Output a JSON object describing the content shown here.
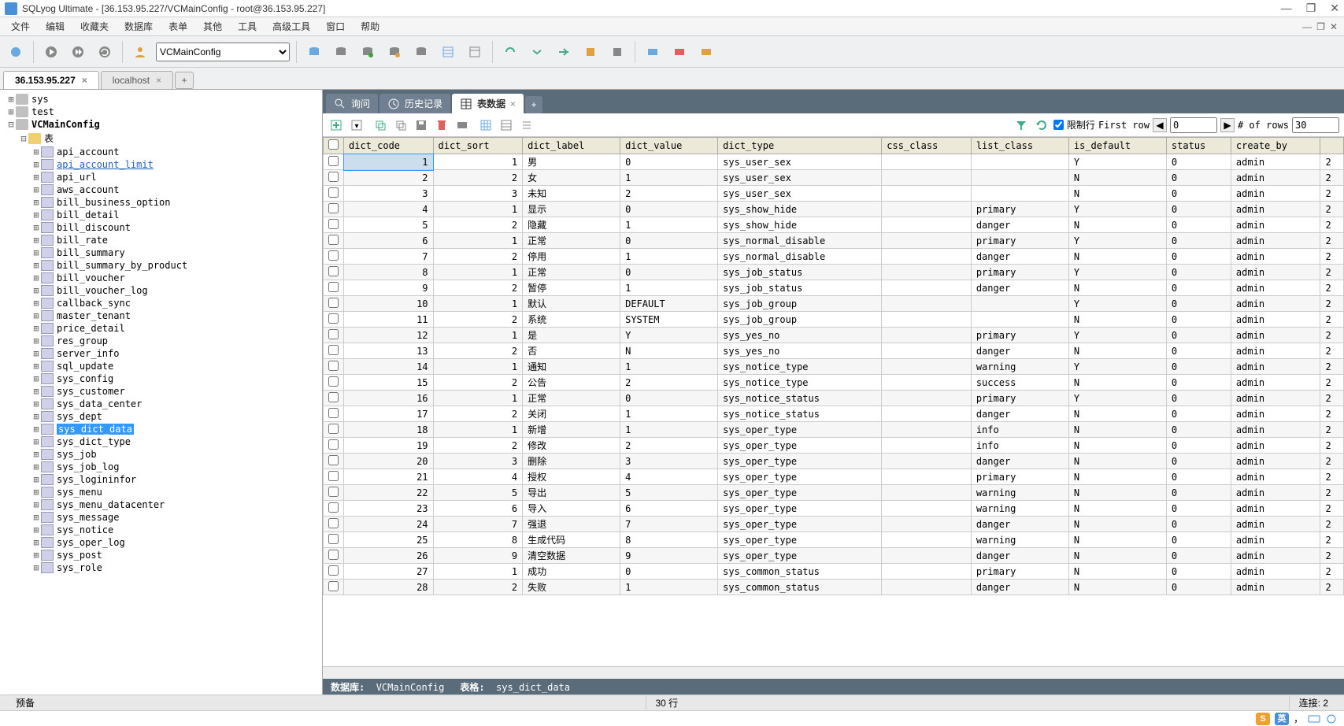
{
  "title": "SQLyog Ultimate - [36.153.95.227/VCMainConfig - root@36.153.95.227]",
  "menus": [
    "文件",
    "编辑",
    "收藏夹",
    "数据库",
    "表单",
    "其他",
    "工具",
    "高级工具",
    "窗口",
    "帮助"
  ],
  "db_selector": "VCMainConfig",
  "conn_tabs": [
    {
      "label": "36.153.95.227",
      "active": true
    },
    {
      "label": "localhost",
      "active": false
    }
  ],
  "tree": {
    "databases": [
      {
        "name": "sys",
        "expanded": false
      },
      {
        "name": "test",
        "expanded": false
      },
      {
        "name": "VCMainConfig",
        "expanded": true,
        "bold": true
      }
    ],
    "tables_folder_label": "表",
    "tables": [
      {
        "name": "api_account"
      },
      {
        "name": "api_account_limit",
        "hover": true
      },
      {
        "name": "api_url"
      },
      {
        "name": "aws_account"
      },
      {
        "name": "bill_business_option"
      },
      {
        "name": "bill_detail"
      },
      {
        "name": "bill_discount"
      },
      {
        "name": "bill_rate"
      },
      {
        "name": "bill_summary"
      },
      {
        "name": "bill_summary_by_product"
      },
      {
        "name": "bill_voucher"
      },
      {
        "name": "bill_voucher_log"
      },
      {
        "name": "callback_sync"
      },
      {
        "name": "master_tenant"
      },
      {
        "name": "price_detail"
      },
      {
        "name": "res_group"
      },
      {
        "name": "server_info"
      },
      {
        "name": "sql_update"
      },
      {
        "name": "sys_config"
      },
      {
        "name": "sys_customer"
      },
      {
        "name": "sys_data_center"
      },
      {
        "name": "sys_dept"
      },
      {
        "name": "sys_dict_data",
        "selected": true
      },
      {
        "name": "sys_dict_type"
      },
      {
        "name": "sys_job"
      },
      {
        "name": "sys_job_log"
      },
      {
        "name": "sys_logininfor"
      },
      {
        "name": "sys_menu"
      },
      {
        "name": "sys_menu_datacenter"
      },
      {
        "name": "sys_message"
      },
      {
        "name": "sys_notice"
      },
      {
        "name": "sys_oper_log"
      },
      {
        "name": "sys_post"
      },
      {
        "name": "sys_role"
      }
    ]
  },
  "content_tabs": [
    {
      "label": "询问",
      "icon": "query",
      "active": false
    },
    {
      "label": "历史记录",
      "icon": "history",
      "active": false
    },
    {
      "label": "表数据",
      "icon": "table",
      "active": true
    }
  ],
  "paging": {
    "limit_label": "限制行",
    "first_row_label": "First row",
    "first_row_value": "0",
    "num_rows_label": "# of rows",
    "num_rows_value": "30"
  },
  "columns": [
    "dict_code",
    "dict_sort",
    "dict_label",
    "dict_value",
    "dict_type",
    "css_class",
    "list_class",
    "is_default",
    "status",
    "create_by"
  ],
  "rows": [
    {
      "dict_code": "1",
      "dict_sort": "1",
      "dict_label": "男",
      "dict_value": "0",
      "dict_type": "sys_user_sex",
      "css_class": "",
      "list_class": "",
      "is_default": "Y",
      "status": "0",
      "create_by": "admin",
      "extra": "2"
    },
    {
      "dict_code": "2",
      "dict_sort": "2",
      "dict_label": "女",
      "dict_value": "1",
      "dict_type": "sys_user_sex",
      "css_class": "",
      "list_class": "",
      "is_default": "N",
      "status": "0",
      "create_by": "admin",
      "extra": "2"
    },
    {
      "dict_code": "3",
      "dict_sort": "3",
      "dict_label": "未知",
      "dict_value": "2",
      "dict_type": "sys_user_sex",
      "css_class": "",
      "list_class": "",
      "is_default": "N",
      "status": "0",
      "create_by": "admin",
      "extra": "2"
    },
    {
      "dict_code": "4",
      "dict_sort": "1",
      "dict_label": "显示",
      "dict_value": "0",
      "dict_type": "sys_show_hide",
      "css_class": "",
      "list_class": "primary",
      "is_default": "Y",
      "status": "0",
      "create_by": "admin",
      "extra": "2"
    },
    {
      "dict_code": "5",
      "dict_sort": "2",
      "dict_label": "隐藏",
      "dict_value": "1",
      "dict_type": "sys_show_hide",
      "css_class": "",
      "list_class": "danger",
      "is_default": "N",
      "status": "0",
      "create_by": "admin",
      "extra": "2"
    },
    {
      "dict_code": "6",
      "dict_sort": "1",
      "dict_label": "正常",
      "dict_value": "0",
      "dict_type": "sys_normal_disable",
      "css_class": "",
      "list_class": "primary",
      "is_default": "Y",
      "status": "0",
      "create_by": "admin",
      "extra": "2"
    },
    {
      "dict_code": "7",
      "dict_sort": "2",
      "dict_label": "停用",
      "dict_value": "1",
      "dict_type": "sys_normal_disable",
      "css_class": "",
      "list_class": "danger",
      "is_default": "N",
      "status": "0",
      "create_by": "admin",
      "extra": "2"
    },
    {
      "dict_code": "8",
      "dict_sort": "1",
      "dict_label": "正常",
      "dict_value": "0",
      "dict_type": "sys_job_status",
      "css_class": "",
      "list_class": "primary",
      "is_default": "Y",
      "status": "0",
      "create_by": "admin",
      "extra": "2"
    },
    {
      "dict_code": "9",
      "dict_sort": "2",
      "dict_label": "暂停",
      "dict_value": "1",
      "dict_type": "sys_job_status",
      "css_class": "",
      "list_class": "danger",
      "is_default": "N",
      "status": "0",
      "create_by": "admin",
      "extra": "2"
    },
    {
      "dict_code": "10",
      "dict_sort": "1",
      "dict_label": "默认",
      "dict_value": "DEFAULT",
      "dict_type": "sys_job_group",
      "css_class": "",
      "list_class": "",
      "is_default": "Y",
      "status": "0",
      "create_by": "admin",
      "extra": "2"
    },
    {
      "dict_code": "11",
      "dict_sort": "2",
      "dict_label": "系统",
      "dict_value": "SYSTEM",
      "dict_type": "sys_job_group",
      "css_class": "",
      "list_class": "",
      "is_default": "N",
      "status": "0",
      "create_by": "admin",
      "extra": "2"
    },
    {
      "dict_code": "12",
      "dict_sort": "1",
      "dict_label": "是",
      "dict_value": "Y",
      "dict_type": "sys_yes_no",
      "css_class": "",
      "list_class": "primary",
      "is_default": "Y",
      "status": "0",
      "create_by": "admin",
      "extra": "2"
    },
    {
      "dict_code": "13",
      "dict_sort": "2",
      "dict_label": "否",
      "dict_value": "N",
      "dict_type": "sys_yes_no",
      "css_class": "",
      "list_class": "danger",
      "is_default": "N",
      "status": "0",
      "create_by": "admin",
      "extra": "2"
    },
    {
      "dict_code": "14",
      "dict_sort": "1",
      "dict_label": "通知",
      "dict_value": "1",
      "dict_type": "sys_notice_type",
      "css_class": "",
      "list_class": "warning",
      "is_default": "Y",
      "status": "0",
      "create_by": "admin",
      "extra": "2"
    },
    {
      "dict_code": "15",
      "dict_sort": "2",
      "dict_label": "公告",
      "dict_value": "2",
      "dict_type": "sys_notice_type",
      "css_class": "",
      "list_class": "success",
      "is_default": "N",
      "status": "0",
      "create_by": "admin",
      "extra": "2"
    },
    {
      "dict_code": "16",
      "dict_sort": "1",
      "dict_label": "正常",
      "dict_value": "0",
      "dict_type": "sys_notice_status",
      "css_class": "",
      "list_class": "primary",
      "is_default": "Y",
      "status": "0",
      "create_by": "admin",
      "extra": "2"
    },
    {
      "dict_code": "17",
      "dict_sort": "2",
      "dict_label": "关闭",
      "dict_value": "1",
      "dict_type": "sys_notice_status",
      "css_class": "",
      "list_class": "danger",
      "is_default": "N",
      "status": "0",
      "create_by": "admin",
      "extra": "2"
    },
    {
      "dict_code": "18",
      "dict_sort": "1",
      "dict_label": "新增",
      "dict_value": "1",
      "dict_type": "sys_oper_type",
      "css_class": "",
      "list_class": "info",
      "is_default": "N",
      "status": "0",
      "create_by": "admin",
      "extra": "2"
    },
    {
      "dict_code": "19",
      "dict_sort": "2",
      "dict_label": "修改",
      "dict_value": "2",
      "dict_type": "sys_oper_type",
      "css_class": "",
      "list_class": "info",
      "is_default": "N",
      "status": "0",
      "create_by": "admin",
      "extra": "2"
    },
    {
      "dict_code": "20",
      "dict_sort": "3",
      "dict_label": "删除",
      "dict_value": "3",
      "dict_type": "sys_oper_type",
      "css_class": "",
      "list_class": "danger",
      "is_default": "N",
      "status": "0",
      "create_by": "admin",
      "extra": "2"
    },
    {
      "dict_code": "21",
      "dict_sort": "4",
      "dict_label": "授权",
      "dict_value": "4",
      "dict_type": "sys_oper_type",
      "css_class": "",
      "list_class": "primary",
      "is_default": "N",
      "status": "0",
      "create_by": "admin",
      "extra": "2"
    },
    {
      "dict_code": "22",
      "dict_sort": "5",
      "dict_label": "导出",
      "dict_value": "5",
      "dict_type": "sys_oper_type",
      "css_class": "",
      "list_class": "warning",
      "is_default": "N",
      "status": "0",
      "create_by": "admin",
      "extra": "2"
    },
    {
      "dict_code": "23",
      "dict_sort": "6",
      "dict_label": "导入",
      "dict_value": "6",
      "dict_type": "sys_oper_type",
      "css_class": "",
      "list_class": "warning",
      "is_default": "N",
      "status": "0",
      "create_by": "admin",
      "extra": "2"
    },
    {
      "dict_code": "24",
      "dict_sort": "7",
      "dict_label": "强退",
      "dict_value": "7",
      "dict_type": "sys_oper_type",
      "css_class": "",
      "list_class": "danger",
      "is_default": "N",
      "status": "0",
      "create_by": "admin",
      "extra": "2"
    },
    {
      "dict_code": "25",
      "dict_sort": "8",
      "dict_label": "生成代码",
      "dict_value": "8",
      "dict_type": "sys_oper_type",
      "css_class": "",
      "list_class": "warning",
      "is_default": "N",
      "status": "0",
      "create_by": "admin",
      "extra": "2"
    },
    {
      "dict_code": "26",
      "dict_sort": "9",
      "dict_label": "清空数据",
      "dict_value": "9",
      "dict_type": "sys_oper_type",
      "css_class": "",
      "list_class": "danger",
      "is_default": "N",
      "status": "0",
      "create_by": "admin",
      "extra": "2"
    },
    {
      "dict_code": "27",
      "dict_sort": "1",
      "dict_label": "成功",
      "dict_value": "0",
      "dict_type": "sys_common_status",
      "css_class": "",
      "list_class": "primary",
      "is_default": "N",
      "status": "0",
      "create_by": "admin",
      "extra": "2"
    },
    {
      "dict_code": "28",
      "dict_sort": "2",
      "dict_label": "失败",
      "dict_value": "1",
      "dict_type": "sys_common_status",
      "css_class": "",
      "list_class": "danger",
      "is_default": "N",
      "status": "0",
      "create_by": "admin",
      "extra": "2"
    }
  ],
  "grid_status": {
    "db_label": "数据库:",
    "db_value": "VCMainConfig",
    "table_label": "表格:",
    "table_value": "sys_dict_data"
  },
  "status": {
    "left": "预备",
    "rows": "30 行",
    "conn": "连接: 2"
  },
  "ime": {
    "a": "S",
    "b": "英",
    "c": "，"
  }
}
